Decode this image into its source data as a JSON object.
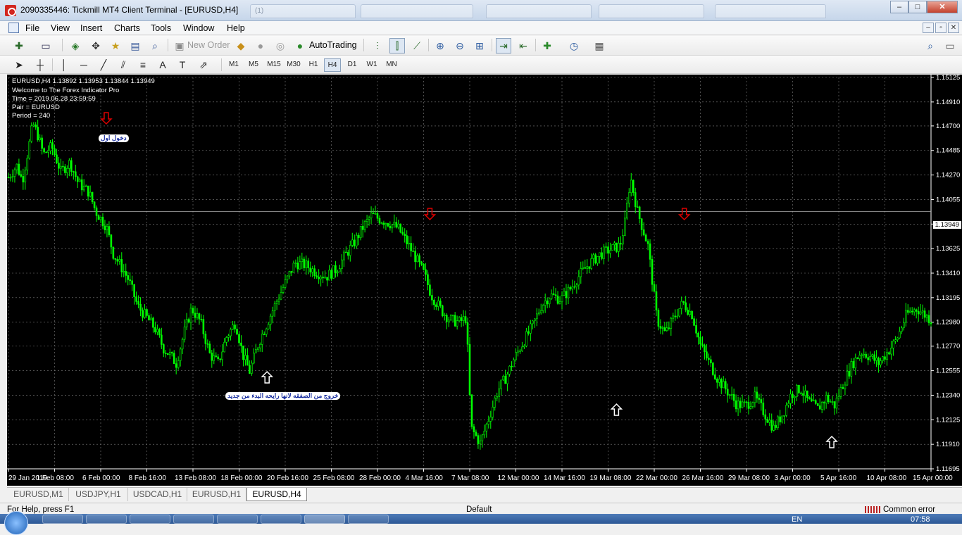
{
  "window": {
    "title": "2090335446: Tickmill MT4 Client Terminal - [EURUSD,H4]",
    "controls": [
      "–",
      "□",
      "✕"
    ],
    "ghost_tabs": [
      {
        "label": "(1)",
        "x": 355,
        "w": 150
      },
      {
        "label": "",
        "x": 512,
        "w": 160
      },
      {
        "label": "",
        "x": 690,
        "w": 150
      },
      {
        "label": "",
        "x": 850,
        "w": 150
      },
      {
        "label": "",
        "x": 1015,
        "w": 158
      }
    ]
  },
  "menu": {
    "items": [
      "File",
      "View",
      "Insert",
      "Charts",
      "Tools",
      "Window",
      "Help"
    ],
    "mdi_controls": [
      "–",
      "▫",
      "✕"
    ]
  },
  "toolbar": {
    "new_order": "New Order",
    "auto_trading": "AutoTrading"
  },
  "timeframes": [
    "M1",
    "M5",
    "M15",
    "M30",
    "H1",
    "H4",
    "D1",
    "W1",
    "MN"
  ],
  "timeframe_active": "H4",
  "chart": {
    "symbol_line": "EURUSD,H4  1.13892 1.13953 1.13844 1.13949",
    "info_lines": [
      "Welcome to The Forex Indicator Pro",
      "Time = 2019.06.28 23:59:59",
      "Pair = EURUSD",
      "Period = 240"
    ],
    "annotation_entry": "دخول اول",
    "annotation_exit": "خروج من الصفقه لانها رايحه البدء من جديد",
    "current_price": "1.13949",
    "colors": {
      "background": "#000000",
      "candle": "#00ff00",
      "grid": "#808080",
      "sell_arrow": "#e00000",
      "buy_arrow": "#ffffff"
    }
  },
  "chart_data": {
    "type": "line",
    "title": "",
    "symbol": "EURUSD",
    "timeframe": "H4",
    "ylim": [
      1.11695,
      1.15125
    ],
    "y_ticks": [
      "1.15125",
      "1.14910",
      "1.14700",
      "1.14485",
      "1.14270",
      "1.14055",
      "1.13840",
      "1.13625",
      "1.13410",
      "1.13195",
      "1.12980",
      "1.12770",
      "1.12555",
      "1.12340",
      "1.12125",
      "1.11910",
      "1.11695"
    ],
    "x_ticks": [
      "29 Jan 2019",
      "1 Feb 08:00",
      "6 Feb 00:00",
      "8 Feb 16:00",
      "13 Feb 08:00",
      "18 Feb 00:00",
      "20 Feb 16:00",
      "25 Feb 08:00",
      "28 Feb 00:00",
      "4 Mar 16:00",
      "7 Mar 08:00",
      "12 Mar 00:00",
      "14 Mar 16:00",
      "19 Mar 08:00",
      "22 Mar 00:00",
      "26 Mar 16:00",
      "29 Mar 08:00",
      "3 Apr 00:00",
      "5 Apr 16:00",
      "10 Apr 08:00",
      "15 Apr 00:00"
    ],
    "current_price": 1.13949,
    "ohlc_last": {
      "open": 1.13892,
      "high": 1.13953,
      "low": 1.13844,
      "close": 1.13949
    },
    "series": [
      {
        "x": [
          0,
          12,
          20,
          28,
          35,
          42,
          50,
          62,
          75,
          88,
          100,
          115,
          125,
          140,
          150,
          160,
          172,
          185,
          198,
          210,
          222,
          230,
          240,
          252,
          262,
          275,
          288,
          300,
          312,
          325,
          335,
          345,
          358,
          372,
          385,
          398,
          410,
          425,
          440,
          455,
          470,
          480,
          495,
          508,
          520,
          532,
          545,
          558,
          570,
          582,
          595,
          605,
          620,
          632,
          645,
          655,
          662,
          675,
          688,
          700,
          712,
          725,
          738,
          750,
          762,
          775,
          790,
          805,
          818,
          832,
          848,
          862,
          875,
          882,
          890,
          900,
          915,
          928,
          940,
          952,
          965,
          978,
          990,
          1003,
          1015,
          1028,
          1042,
          1055,
          1068,
          1082,
          1095,
          1108,
          1120,
          1133,
          1145,
          1158,
          1170,
          1182,
          1195,
          1208,
          1220,
          1233,
          1245,
          1258,
          1270,
          1285,
          1300,
          1320
        ],
        "values": [
          1.1425,
          1.1435,
          1.1422,
          1.1448,
          1.1472,
          1.1462,
          1.1445,
          1.1452,
          1.143,
          1.1438,
          1.142,
          1.1412,
          1.1395,
          1.1382,
          1.1358,
          1.1348,
          1.1335,
          1.1312,
          1.1302,
          1.1292,
          1.1275,
          1.127,
          1.1262,
          1.129,
          1.131,
          1.1298,
          1.127,
          1.1262,
          1.1285,
          1.1298,
          1.127,
          1.1255,
          1.128,
          1.13,
          1.1318,
          1.1335,
          1.135,
          1.1348,
          1.1342,
          1.1338,
          1.1345,
          1.1355,
          1.1368,
          1.1382,
          1.1392,
          1.1388,
          1.1385,
          1.138,
          1.1368,
          1.1355,
          1.134,
          1.1322,
          1.1308,
          1.13,
          1.1298,
          1.1302,
          1.1205,
          1.1192,
          1.1215,
          1.1238,
          1.125,
          1.1268,
          1.1282,
          1.1295,
          1.1312,
          1.1322,
          1.1318,
          1.1328,
          1.134,
          1.135,
          1.1358,
          1.1362,
          1.1365,
          1.1385,
          1.1425,
          1.1395,
          1.1365,
          1.13,
          1.1288,
          1.1302,
          1.1315,
          1.1305,
          1.1278,
          1.1262,
          1.1248,
          1.1238,
          1.1226,
          1.1225,
          1.1232,
          1.1218,
          1.1205,
          1.1218,
          1.1235,
          1.124,
          1.1228,
          1.1222,
          1.1232,
          1.1225,
          1.1245,
          1.1262,
          1.1272,
          1.1268,
          1.1262,
          1.1272,
          1.1282,
          1.1305,
          1.131,
          1.13
        ]
      }
    ],
    "signals": [
      {
        "type": "sell",
        "date_index": 140
      },
      {
        "type": "sell",
        "date_index": 603
      },
      {
        "type": "sell",
        "date_index": 967
      },
      {
        "type": "buy",
        "date_index": 370
      },
      {
        "type": "buy",
        "date_index": 870
      },
      {
        "type": "buy",
        "date_index": 1178
      }
    ],
    "grid": true
  },
  "chart_tabs": [
    "EURUSD,M1",
    "USDJPY,H1",
    "USDCAD,H1",
    "EURUSD,H1",
    "EURUSD,H4"
  ],
  "chart_tab_active": "EURUSD,H4",
  "status": {
    "help": "For Help, press F1",
    "profile": "Default",
    "connection": "Common error"
  },
  "taskbar": {
    "lang": "EN",
    "time": "07:58"
  }
}
